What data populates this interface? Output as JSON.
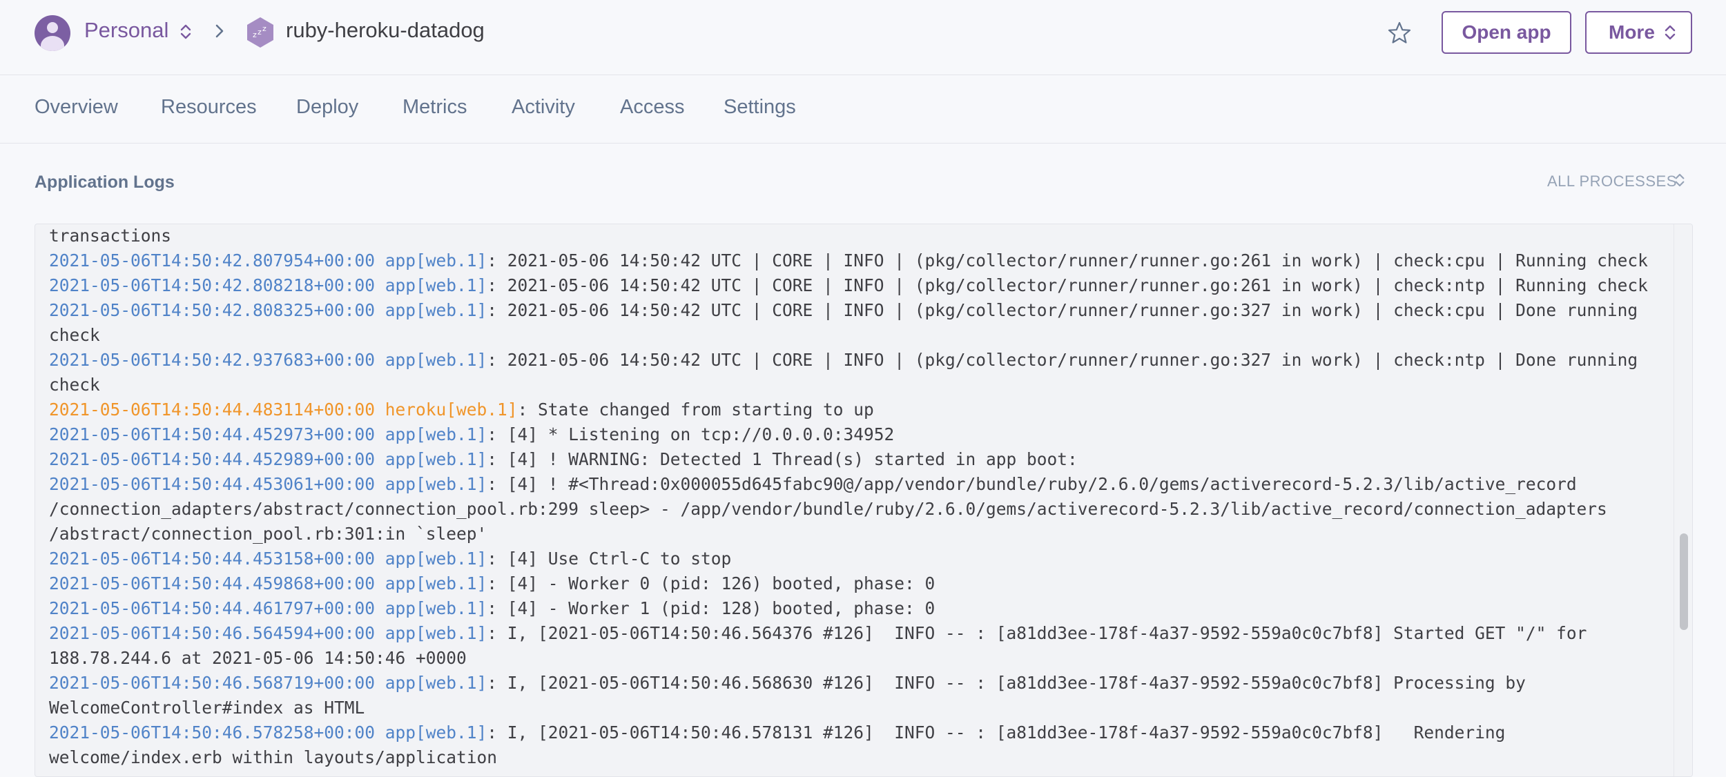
{
  "header": {
    "team_name": "Personal",
    "app_name": "ruby-heroku-datadog",
    "open_app_label": "Open app",
    "more_label": "More"
  },
  "tabs": [
    {
      "label": "Overview"
    },
    {
      "label": "Resources"
    },
    {
      "label": "Deploy"
    },
    {
      "label": "Metrics"
    },
    {
      "label": "Activity"
    },
    {
      "label": "Access"
    },
    {
      "label": "Settings"
    }
  ],
  "logs_section": {
    "title": "Application Logs",
    "process_filter": "ALL PROCESSES"
  },
  "logs": [
    {
      "ts": "",
      "src": "",
      "msg": "transactions",
      "kind": "app"
    },
    {
      "ts": "2021-05-06T14:50:42.807954+00:00",
      "src": "app[web.1]",
      "msg": ": 2021-05-06 14:50:42 UTC | CORE | INFO | (pkg/collector/runner/runner.go:261 in work) | check:cpu | Running check",
      "kind": "app"
    },
    {
      "ts": "2021-05-06T14:50:42.808218+00:00",
      "src": "app[web.1]",
      "msg": ": 2021-05-06 14:50:42 UTC | CORE | INFO | (pkg/collector/runner/runner.go:261 in work) | check:ntp | Running check",
      "kind": "app"
    },
    {
      "ts": "2021-05-06T14:50:42.808325+00:00",
      "src": "app[web.1]",
      "msg": ": 2021-05-06 14:50:42 UTC | CORE | INFO | (pkg/collector/runner/runner.go:327 in work) | check:cpu | Done running check",
      "kind": "app"
    },
    {
      "ts": "2021-05-06T14:50:42.937683+00:00",
      "src": "app[web.1]",
      "msg": ": 2021-05-06 14:50:42 UTC | CORE | INFO | (pkg/collector/runner/runner.go:327 in work) | check:ntp | Done running check",
      "kind": "app"
    },
    {
      "ts": "2021-05-06T14:50:44.483114+00:00",
      "src": "heroku[web.1]",
      "msg": ": State changed from starting to up",
      "kind": "heroku"
    },
    {
      "ts": "2021-05-06T14:50:44.452973+00:00",
      "src": "app[web.1]",
      "msg": ": [4] * Listening on tcp://0.0.0.0:34952",
      "kind": "app"
    },
    {
      "ts": "2021-05-06T14:50:44.452989+00:00",
      "src": "app[web.1]",
      "msg": ": [4] ! WARNING: Detected 1 Thread(s) started in app boot:",
      "kind": "app"
    },
    {
      "ts": "2021-05-06T14:50:44.453061+00:00",
      "src": "app[web.1]",
      "msg": ": [4] ! #<Thread:0x000055d645fabc90@/app/vendor/bundle/ruby/2.6.0/gems/activerecord-5.2.3/lib/active_record /connection_adapters/abstract/connection_pool.rb:299 sleep> - /app/vendor/bundle/ruby/2.6.0/gems/activerecord-5.2.3/lib/active_record/connection_adapters /abstract/connection_pool.rb:301:in `sleep'",
      "kind": "app"
    },
    {
      "ts": "2021-05-06T14:50:44.453158+00:00",
      "src": "app[web.1]",
      "msg": ": [4] Use Ctrl-C to stop",
      "kind": "app"
    },
    {
      "ts": "2021-05-06T14:50:44.459868+00:00",
      "src": "app[web.1]",
      "msg": ": [4] - Worker 0 (pid: 126) booted, phase: 0",
      "kind": "app"
    },
    {
      "ts": "2021-05-06T14:50:44.461797+00:00",
      "src": "app[web.1]",
      "msg": ": [4] - Worker 1 (pid: 128) booted, phase: 0",
      "kind": "app"
    },
    {
      "ts": "2021-05-06T14:50:46.564594+00:00",
      "src": "app[web.1]",
      "msg": ": I, [2021-05-06T14:50:46.564376 #126]  INFO -- : [a81dd3ee-178f-4a37-9592-559a0c0c7bf8] Started GET \"/\" for 188.78.244.6 at 2021-05-06 14:50:46 +0000",
      "kind": "app"
    },
    {
      "ts": "2021-05-06T14:50:46.568719+00:00",
      "src": "app[web.1]",
      "msg": ": I, [2021-05-06T14:50:46.568630 #126]  INFO -- : [a81dd3ee-178f-4a37-9592-559a0c0c7bf8] Processing by WelcomeController#index as HTML",
      "kind": "app"
    },
    {
      "ts": "2021-05-06T14:50:46.578258+00:00",
      "src": "app[web.1]",
      "msg": ": I, [2021-05-06T14:50:46.578131 #126]  INFO -- : [a81dd3ee-178f-4a37-9592-559a0c0c7bf8]   Rendering welcome/index.erb within layouts/application",
      "kind": "app"
    }
  ],
  "colors": {
    "brand": "#79589f",
    "log_timestamp_app": "#5083c8",
    "log_timestamp_heroku": "#f0952a",
    "tab_text": "#62738d"
  },
  "icons": {
    "avatar": "user-avatar-icon",
    "team_switch": "updown-chevron-icon",
    "breadcrumb": "chevron-right-icon",
    "app": "sleeping-dyno-hexagon-icon",
    "favorite": "star-icon"
  }
}
